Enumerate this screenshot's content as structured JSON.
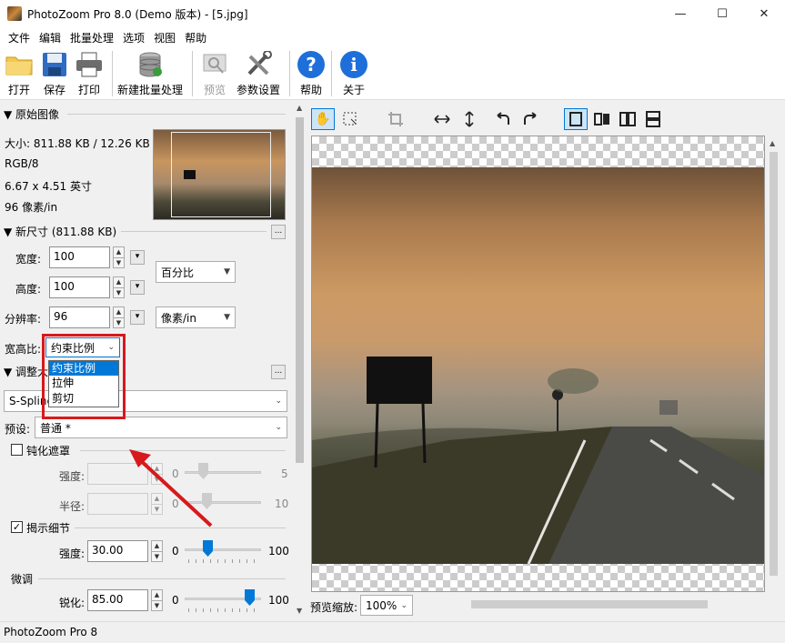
{
  "window": {
    "title": "PhotoZoom Pro 8.0 (Demo 版本) - [5.jpg]",
    "min": "—",
    "max": "☐",
    "close": "✕"
  },
  "menu": [
    "文件",
    "编辑",
    "批量处理",
    "选项",
    "视图",
    "帮助"
  ],
  "toolbar": {
    "open": "打开",
    "save": "保存",
    "print": "打印",
    "batch": "新建批量处理",
    "preview": "预览",
    "settings": "参数设置",
    "help": "帮助",
    "about": "关于"
  },
  "original": {
    "header": "原始图像",
    "size": "大小: 811.88 KB / 12.26 KB",
    "mode": "RGB/8",
    "dims": "6.67 x 4.51 英寸",
    "res": "96 像素/in"
  },
  "newsize": {
    "header": "新尺寸 (811.88 KB)",
    "more": "...",
    "width_label": "宽度:",
    "width": "100",
    "height_label": "高度:",
    "height": "100",
    "res_label": "分辨率:",
    "res": "96",
    "unit1": "百分比",
    "unit2": "像素/in"
  },
  "aspect": {
    "label": "宽高比:",
    "selected": "约束比例",
    "options": [
      "约束比例",
      "拉伸",
      "剪切"
    ]
  },
  "adjust": {
    "header": "调整大",
    "more": "...",
    "method": "S-Spline",
    "preset_label": "预设:",
    "preset": "普通 *"
  },
  "unsharp": {
    "label": "钝化遮罩",
    "strength_label": "强度:",
    "strength_min": "0",
    "strength_max": "5",
    "radius_label": "半径:",
    "radius_min": "0",
    "radius_max": "10"
  },
  "detail": {
    "label": "揭示细节",
    "strength_label": "强度:",
    "strength": "30.00",
    "min": "0",
    "max": "100",
    "level": 0.3
  },
  "finetune": {
    "header": "微调",
    "sharp_label": "锐化:",
    "sharp": "85.00",
    "min": "0",
    "max": "100",
    "level": 0.85
  },
  "preview": {
    "zoom_label": "预览缩放:",
    "zoom": "100%"
  },
  "status": {
    "text": "PhotoZoom Pro 8"
  },
  "colors": {
    "accent": "#0078d7",
    "highlight": "#d7191c",
    "helpblue": "#1e6fd9"
  }
}
